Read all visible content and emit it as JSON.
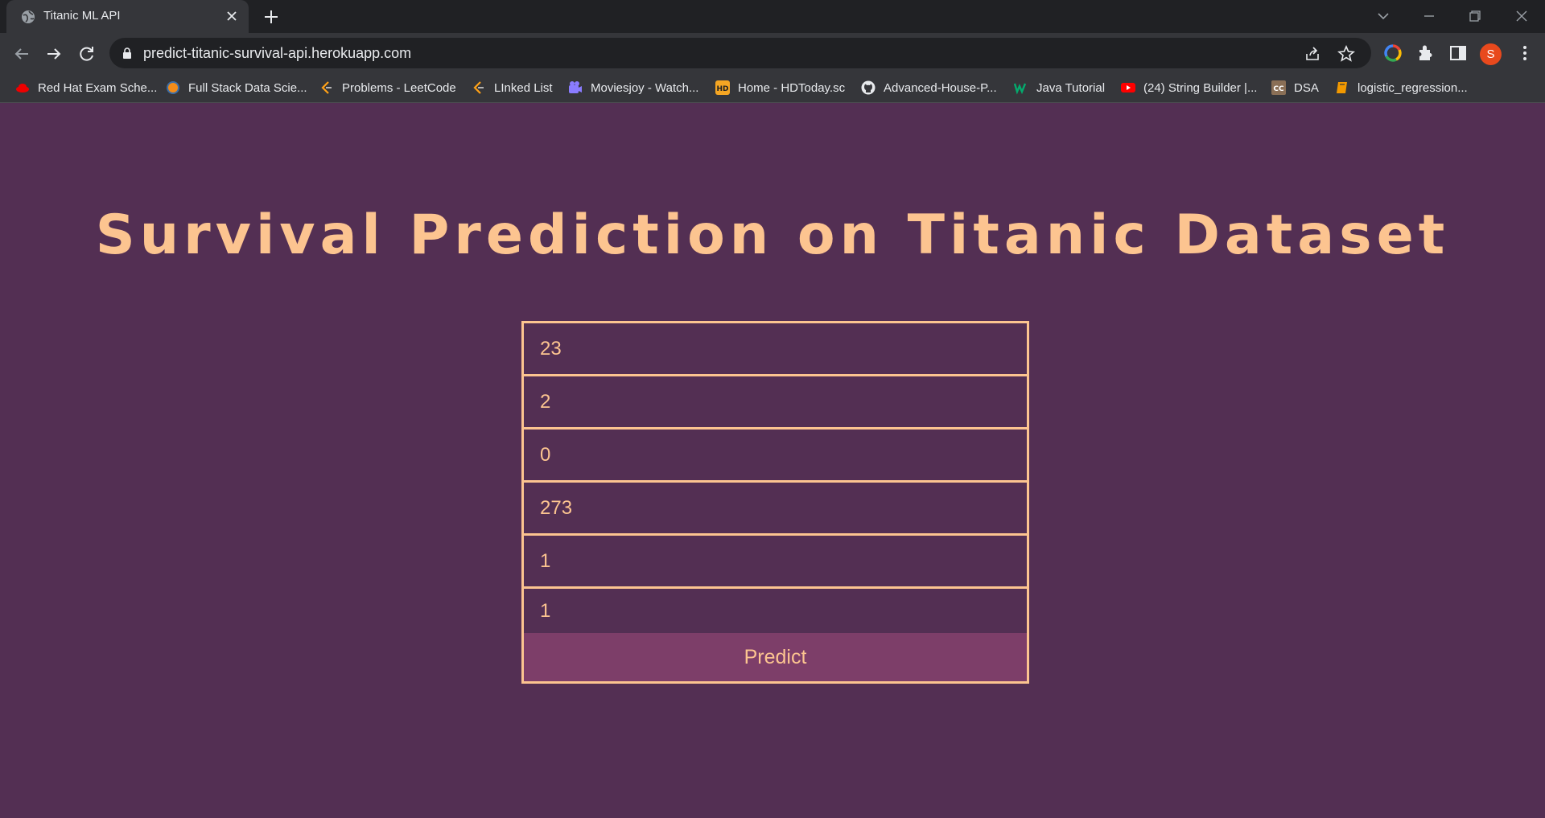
{
  "browser": {
    "tab": {
      "title": "Titanic ML API",
      "favicon": "globe-icon"
    },
    "url": "predict-titanic-survival-api.herokuapp.com",
    "profile_initial": "S",
    "bookmarks": [
      {
        "label": "Red Hat Exam Sche...",
        "icon": "redhat-icon"
      },
      {
        "label": "Full Stack Data Scie...",
        "icon": "orange-circle-icon"
      },
      {
        "label": "Problems - LeetCode",
        "icon": "leetcode-icon"
      },
      {
        "label": "LInked List",
        "icon": "leetcode-icon"
      },
      {
        "label": "Moviesjoy - Watch...",
        "icon": "moviesjoy-icon"
      },
      {
        "label": "Home - HDToday.sc",
        "icon": "hd-icon"
      },
      {
        "label": "Advanced-House-P...",
        "icon": "github-icon"
      },
      {
        "label": "Java Tutorial",
        "icon": "w3schools-icon"
      },
      {
        "label": "(24) String Builder |...",
        "icon": "youtube-icon"
      },
      {
        "label": "DSA",
        "icon": "cc-icon"
      },
      {
        "label": "logistic_regression...",
        "icon": "book-icon"
      }
    ]
  },
  "page": {
    "title": "Survival Prediction on Titanic Dataset",
    "fields": [
      {
        "value": "23"
      },
      {
        "value": "2"
      },
      {
        "value": "0"
      },
      {
        "value": "273"
      },
      {
        "value": "1"
      },
      {
        "value": "1"
      }
    ],
    "predict_label": "Predict"
  },
  "colors": {
    "background": "#532f53",
    "accent": "#fcc490",
    "button": "#7d3e69"
  }
}
